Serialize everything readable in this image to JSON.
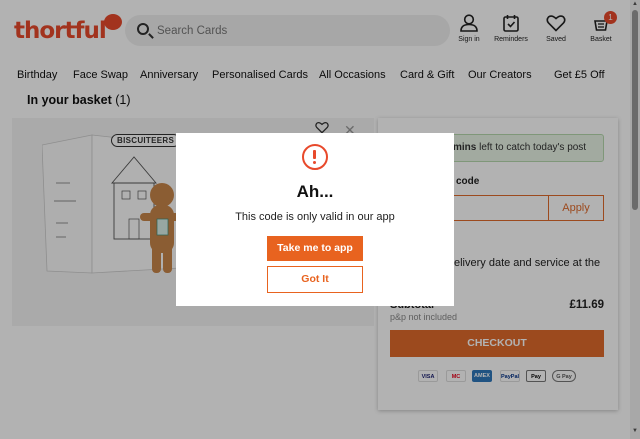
{
  "header": {
    "logo": "thortful",
    "search_placeholder": "Search Cards",
    "sign_in": "Sign in",
    "reminders": "Reminders",
    "saved": "Saved",
    "basket": "Basket",
    "basket_count": "1"
  },
  "nav": {
    "items": [
      "Birthday",
      "Face Swap",
      "Anniversary",
      "Personalised Cards",
      "All Occasions",
      "Card & Gift",
      "Our Creators",
      "Get £5 Off"
    ]
  },
  "basket": {
    "title": "In your basket",
    "count": "(1)"
  },
  "card": {
    "brand": "BISCUITEERS"
  },
  "summary": {
    "timer_bold": "mins",
    "timer_text": " left to catch today's post",
    "promo_label": "code",
    "apply_label": "Apply",
    "delivery_text": "elivery date and service at the",
    "subtotal_label": "Subtotal",
    "subtotal_value": "£11.69",
    "pp_note": "p&p not included",
    "checkout_label": "CHECKOUT",
    "payment_methods": [
      "VISA",
      "MC",
      "AMEX",
      "PayPal",
      "Pay",
      "G Pay"
    ]
  },
  "modal": {
    "title": "Ah...",
    "message": "This code is only valid in our app",
    "primary_label": "Take me to app",
    "secondary_label": "Got It"
  },
  "colors": {
    "brand_red": "#e8492b",
    "action_orange": "#e06a2c"
  }
}
